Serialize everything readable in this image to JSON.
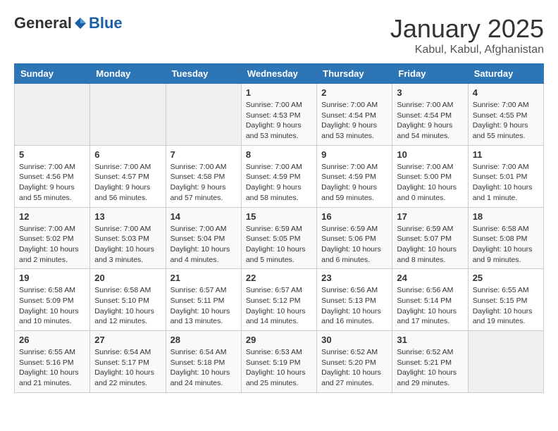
{
  "header": {
    "logo_general": "General",
    "logo_blue": "Blue",
    "title": "January 2025",
    "subtitle": "Kabul, Kabul, Afghanistan"
  },
  "weekdays": [
    "Sunday",
    "Monday",
    "Tuesday",
    "Wednesday",
    "Thursday",
    "Friday",
    "Saturday"
  ],
  "weeks": [
    [
      {
        "day": "",
        "info": ""
      },
      {
        "day": "",
        "info": ""
      },
      {
        "day": "",
        "info": ""
      },
      {
        "day": "1",
        "info": "Sunrise: 7:00 AM\nSunset: 4:53 PM\nDaylight: 9 hours and 53 minutes."
      },
      {
        "day": "2",
        "info": "Sunrise: 7:00 AM\nSunset: 4:54 PM\nDaylight: 9 hours and 53 minutes."
      },
      {
        "day": "3",
        "info": "Sunrise: 7:00 AM\nSunset: 4:54 PM\nDaylight: 9 hours and 54 minutes."
      },
      {
        "day": "4",
        "info": "Sunrise: 7:00 AM\nSunset: 4:55 PM\nDaylight: 9 hours and 55 minutes."
      }
    ],
    [
      {
        "day": "5",
        "info": "Sunrise: 7:00 AM\nSunset: 4:56 PM\nDaylight: 9 hours and 55 minutes."
      },
      {
        "day": "6",
        "info": "Sunrise: 7:00 AM\nSunset: 4:57 PM\nDaylight: 9 hours and 56 minutes."
      },
      {
        "day": "7",
        "info": "Sunrise: 7:00 AM\nSunset: 4:58 PM\nDaylight: 9 hours and 57 minutes."
      },
      {
        "day": "8",
        "info": "Sunrise: 7:00 AM\nSunset: 4:59 PM\nDaylight: 9 hours and 58 minutes."
      },
      {
        "day": "9",
        "info": "Sunrise: 7:00 AM\nSunset: 4:59 PM\nDaylight: 9 hours and 59 minutes."
      },
      {
        "day": "10",
        "info": "Sunrise: 7:00 AM\nSunset: 5:00 PM\nDaylight: 10 hours and 0 minutes."
      },
      {
        "day": "11",
        "info": "Sunrise: 7:00 AM\nSunset: 5:01 PM\nDaylight: 10 hours and 1 minute."
      }
    ],
    [
      {
        "day": "12",
        "info": "Sunrise: 7:00 AM\nSunset: 5:02 PM\nDaylight: 10 hours and 2 minutes."
      },
      {
        "day": "13",
        "info": "Sunrise: 7:00 AM\nSunset: 5:03 PM\nDaylight: 10 hours and 3 minutes."
      },
      {
        "day": "14",
        "info": "Sunrise: 7:00 AM\nSunset: 5:04 PM\nDaylight: 10 hours and 4 minutes."
      },
      {
        "day": "15",
        "info": "Sunrise: 6:59 AM\nSunset: 5:05 PM\nDaylight: 10 hours and 5 minutes."
      },
      {
        "day": "16",
        "info": "Sunrise: 6:59 AM\nSunset: 5:06 PM\nDaylight: 10 hours and 6 minutes."
      },
      {
        "day": "17",
        "info": "Sunrise: 6:59 AM\nSunset: 5:07 PM\nDaylight: 10 hours and 8 minutes."
      },
      {
        "day": "18",
        "info": "Sunrise: 6:58 AM\nSunset: 5:08 PM\nDaylight: 10 hours and 9 minutes."
      }
    ],
    [
      {
        "day": "19",
        "info": "Sunrise: 6:58 AM\nSunset: 5:09 PM\nDaylight: 10 hours and 10 minutes."
      },
      {
        "day": "20",
        "info": "Sunrise: 6:58 AM\nSunset: 5:10 PM\nDaylight: 10 hours and 12 minutes."
      },
      {
        "day": "21",
        "info": "Sunrise: 6:57 AM\nSunset: 5:11 PM\nDaylight: 10 hours and 13 minutes."
      },
      {
        "day": "22",
        "info": "Sunrise: 6:57 AM\nSunset: 5:12 PM\nDaylight: 10 hours and 14 minutes."
      },
      {
        "day": "23",
        "info": "Sunrise: 6:56 AM\nSunset: 5:13 PM\nDaylight: 10 hours and 16 minutes."
      },
      {
        "day": "24",
        "info": "Sunrise: 6:56 AM\nSunset: 5:14 PM\nDaylight: 10 hours and 17 minutes."
      },
      {
        "day": "25",
        "info": "Sunrise: 6:55 AM\nSunset: 5:15 PM\nDaylight: 10 hours and 19 minutes."
      }
    ],
    [
      {
        "day": "26",
        "info": "Sunrise: 6:55 AM\nSunset: 5:16 PM\nDaylight: 10 hours and 21 minutes."
      },
      {
        "day": "27",
        "info": "Sunrise: 6:54 AM\nSunset: 5:17 PM\nDaylight: 10 hours and 22 minutes."
      },
      {
        "day": "28",
        "info": "Sunrise: 6:54 AM\nSunset: 5:18 PM\nDaylight: 10 hours and 24 minutes."
      },
      {
        "day": "29",
        "info": "Sunrise: 6:53 AM\nSunset: 5:19 PM\nDaylight: 10 hours and 25 minutes."
      },
      {
        "day": "30",
        "info": "Sunrise: 6:52 AM\nSunset: 5:20 PM\nDaylight: 10 hours and 27 minutes."
      },
      {
        "day": "31",
        "info": "Sunrise: 6:52 AM\nSunset: 5:21 PM\nDaylight: 10 hours and 29 minutes."
      },
      {
        "day": "",
        "info": ""
      }
    ]
  ]
}
